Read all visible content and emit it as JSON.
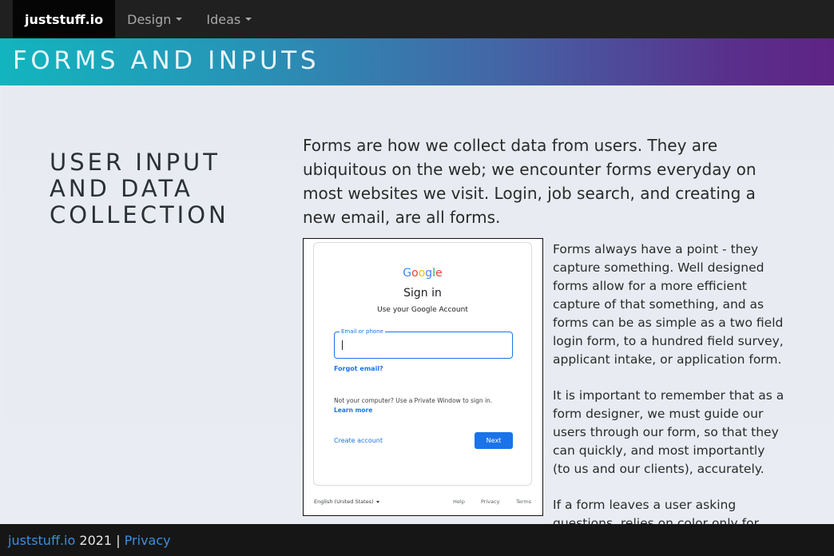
{
  "nav": {
    "brand": "juststuff.io",
    "items": [
      {
        "label": "Design"
      },
      {
        "label": "Ideas"
      }
    ]
  },
  "banner": {
    "title": "FORMS AND INPUTS"
  },
  "section": {
    "heading": "USER INPUT AND DATA COLLECTION",
    "lead": "Forms are how we collect data from users. They are ubiquitous on the web; we encounter forms everyday on most websites we visit. Login, job search, and creating a new email, are all forms.",
    "paragraphs": [
      "Forms always have a point - they capture something. Well designed forms allow for a more efficient capture of that something, and as forms can be as simple as a two field login form, to a hundred field survey, applicant intake, or application form.",
      "It is important to remember that as a form designer, we must guide our users through our form, so that they can quickly, and most importantly (to us and our clients), accurately.",
      "If a form leaves a user asking questions, relies on color only for"
    ]
  },
  "google_signin": {
    "logo_letters": [
      "G",
      "o",
      "o",
      "g",
      "l",
      "e"
    ],
    "title": "Sign in",
    "subtitle": "Use your Google Account",
    "email_label": "Email or phone",
    "forgot": "Forgot email?",
    "not_your_computer": "Not your computer? Use a Private Window to sign in.",
    "learn_more": "Learn more",
    "create_account": "Create account",
    "next": "Next",
    "language": "English (United States)",
    "footer_links": [
      "Help",
      "Privacy",
      "Terms"
    ],
    "colors": {
      "blue": "#4285f4",
      "red": "#ea4335",
      "yellow": "#fbbc05",
      "green": "#34a853",
      "button": "#1a73e8"
    }
  },
  "footer": {
    "brand_link": "juststuff.io",
    "year": " 2021 | ",
    "privacy_link": "Privacy"
  },
  "theme": {
    "gradient": [
      "#12b5bf",
      "#4366a6",
      "#5e2385"
    ],
    "link": "#3a8fe0"
  }
}
